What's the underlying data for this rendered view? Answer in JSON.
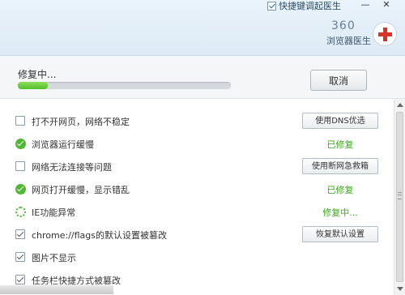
{
  "header": {
    "shortcut_label": "快捷键调起医生",
    "brand_number": "360",
    "brand_name": "浏览器医生",
    "minimize": "—",
    "close": "✕"
  },
  "progress": {
    "status_text": "修复中...",
    "percent": 14,
    "cancel_label": "取消"
  },
  "items": [
    {
      "icon": "checkbox",
      "label": "打不开网页，网络不稳定",
      "action": "使用DNS优选",
      "type": "button"
    },
    {
      "icon": "ok",
      "label": "浏览器运行缓慢",
      "action": "已修复",
      "type": "status"
    },
    {
      "icon": "checkbox",
      "label": "网络无法连接等问题",
      "action": "使用断网急救箱",
      "type": "button"
    },
    {
      "icon": "ok",
      "label": "网页打开缓慢，显示错乱",
      "action": "已修复",
      "type": "status"
    },
    {
      "icon": "spinner",
      "label": "IE功能异常",
      "action": "修复中...",
      "type": "status"
    },
    {
      "icon": "checked",
      "label": "chrome://flags的默认设置被篡改",
      "action": "恢复默认设置",
      "type": "button"
    },
    {
      "icon": "checked",
      "label": "图片不显示",
      "action": "",
      "type": "none"
    },
    {
      "icon": "checked",
      "label": "任务栏快捷方式被篡改",
      "action": "",
      "type": "none"
    }
  ]
}
